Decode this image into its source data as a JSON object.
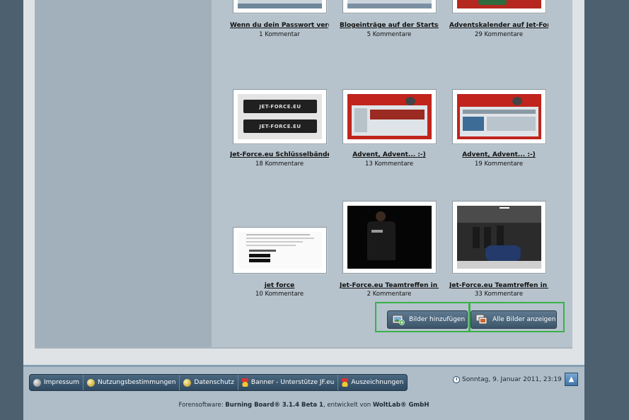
{
  "gallery": {
    "items": [
      {
        "title": "Wenn du dein Passwort verges",
        "count": "1 Kommentar"
      },
      {
        "title": "Blogeinträge auf der Startseite",
        "count": "5 Kommentare"
      },
      {
        "title": "Adventskalender auf Jet-Force",
        "count": "29 Kommentare"
      },
      {
        "title": "Jet-Force.eu Schlüsselbänder",
        "count": "18 Kommentare"
      },
      {
        "title": "Advent, Advent... :-)",
        "count": "13 Kommentare"
      },
      {
        "title": "Advent, Advent... :-)",
        "count": "19 Kommentare"
      },
      {
        "title": "jet force",
        "count": "10 Kommentare"
      },
      {
        "title": "Jet-Force.eu Teamtreffen in O",
        "count": "2 Kommentare"
      },
      {
        "title": "Jet-Force.eu Teamtreffen in O",
        "count": "33 Kommentare"
      }
    ],
    "lanyard_text": "JET-FORCE.EU",
    "add_button": "Bilder hinzufügen",
    "all_button": "Alle Bilder anzeigen",
    "highlight_color": "#3ab04a"
  },
  "footer": {
    "nav": [
      {
        "label": "Impressum",
        "icon": "info-icon"
      },
      {
        "label": "Nutzungsbestimmungen",
        "icon": "info-icon"
      },
      {
        "label": "Datenschutz",
        "icon": "info-icon"
      },
      {
        "label": "Banner - Unterstütze JF.eu",
        "icon": "medal-icon"
      },
      {
        "label": "Auszeichnungen",
        "icon": "medal-icon"
      }
    ],
    "datetime": "Sonntag, 9. Januar 2011, 23:19",
    "credits_prefix": "Forensoftware: ",
    "credits_product": "Burning Board® 3.1.4 Beta 1",
    "credits_middle": ", entwickelt von ",
    "credits_vendor": "WoltLab® GmbH"
  }
}
